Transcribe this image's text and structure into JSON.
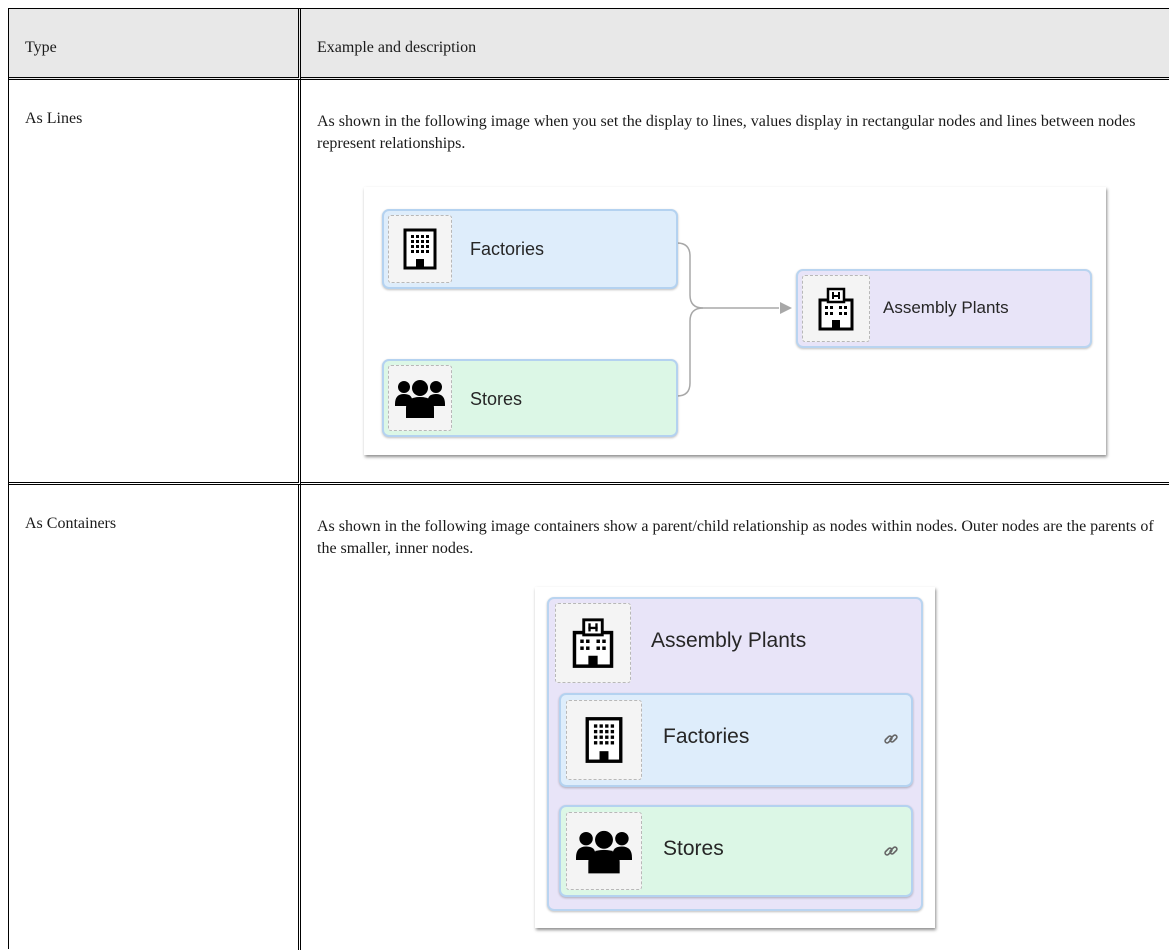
{
  "table": {
    "headers": {
      "type": "Type",
      "example": "Example and description"
    },
    "rows": [
      {
        "type": "As Lines",
        "description": "As shown in the following image when you set the display to lines, values display in rectangular nodes and lines between nodes represent relationships.",
        "diagram": {
          "nodes": [
            {
              "label": "Factories",
              "icon": "factory-building-icon"
            },
            {
              "label": "Stores",
              "icon": "people-group-icon"
            },
            {
              "label": "Assembly Plants",
              "icon": "hospital-building-icon"
            }
          ]
        }
      },
      {
        "type": "As Containers",
        "description": "As shown in the following image containers show a parent/child relationship as nodes within nodes. Outer nodes are the parents of the smaller, inner nodes.",
        "diagram": {
          "parent": {
            "label": "Assembly Plants",
            "icon": "hospital-building-icon"
          },
          "children": [
            {
              "label": "Factories",
              "icon": "factory-building-icon",
              "action_icon": "link-icon"
            },
            {
              "label": "Stores",
              "icon": "people-group-icon",
              "action_icon": "link-icon"
            }
          ]
        }
      }
    ]
  },
  "colors": {
    "header_bg": "#e8e8e8",
    "node_blue": "#deedfb",
    "node_green": "#dcf7e6",
    "node_purple": "#e8e4f8",
    "node_border": "#b4d2f0"
  }
}
